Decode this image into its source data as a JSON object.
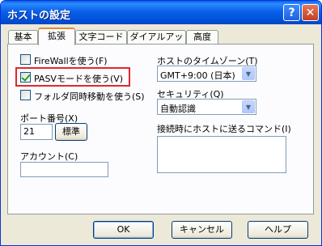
{
  "window": {
    "title": "ホストの設定",
    "help_glyph": "?",
    "close_glyph": "✕"
  },
  "tabs": [
    {
      "label": "基本"
    },
    {
      "label": "拡張"
    },
    {
      "label": "文字コード"
    },
    {
      "label": "ダイアルアップ"
    },
    {
      "label": "高度"
    }
  ],
  "active_tab": "拡張",
  "options": {
    "firewall": {
      "label": "FireWallを使う(F)",
      "checked": false
    },
    "pasv": {
      "label": "PASVモードを使う(V)",
      "checked": true
    },
    "sync_move": {
      "label": "フォルダ同時移動を使う(S)",
      "checked": false
    }
  },
  "port": {
    "label": "ポート番号(X)",
    "value": "21",
    "standard_button": "標準"
  },
  "account": {
    "label": "アカウント(C)",
    "value": ""
  },
  "timezone": {
    "label": "ホストのタイムゾーン(T)",
    "value": "GMT+9:00 (日本)"
  },
  "security": {
    "label": "セキュリティ(Q)",
    "value": "自動認識"
  },
  "command": {
    "label": "接続時にホストに送るコマンド(I)",
    "value": ""
  },
  "buttons": {
    "ok": "OK",
    "cancel": "キャンセル",
    "help": "ヘルプ"
  }
}
